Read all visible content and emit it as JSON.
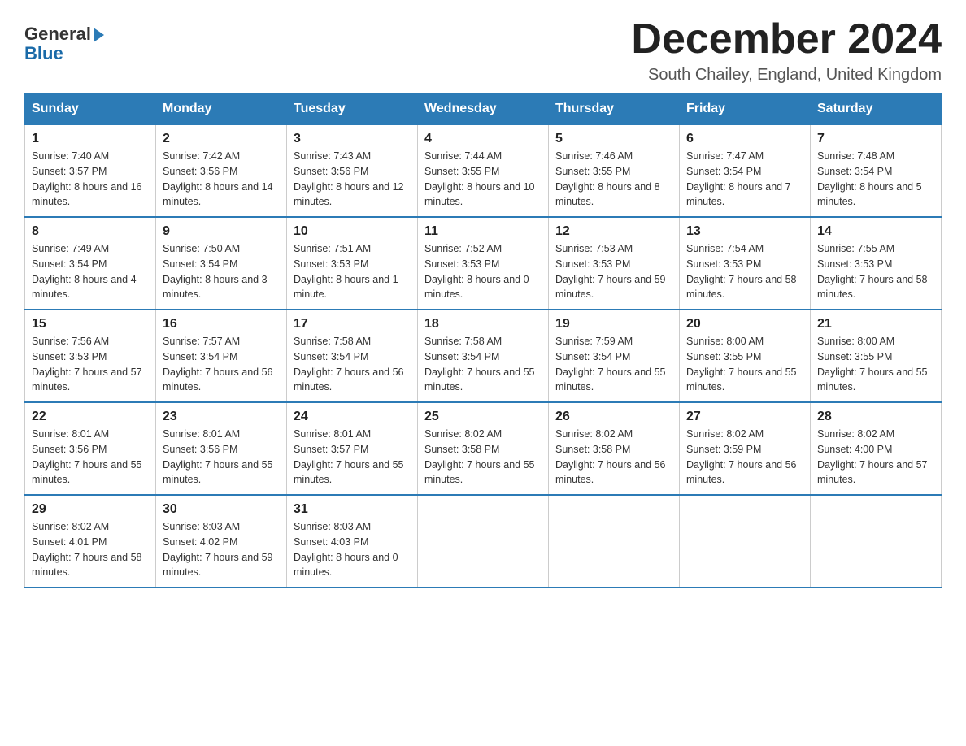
{
  "header": {
    "logo_general": "General",
    "logo_blue": "Blue",
    "title": "December 2024",
    "location": "South Chailey, England, United Kingdom"
  },
  "columns": [
    "Sunday",
    "Monday",
    "Tuesday",
    "Wednesday",
    "Thursday",
    "Friday",
    "Saturday"
  ],
  "weeks": [
    [
      {
        "day": "1",
        "sunrise": "7:40 AM",
        "sunset": "3:57 PM",
        "daylight": "8 hours and 16 minutes."
      },
      {
        "day": "2",
        "sunrise": "7:42 AM",
        "sunset": "3:56 PM",
        "daylight": "8 hours and 14 minutes."
      },
      {
        "day": "3",
        "sunrise": "7:43 AM",
        "sunset": "3:56 PM",
        "daylight": "8 hours and 12 minutes."
      },
      {
        "day": "4",
        "sunrise": "7:44 AM",
        "sunset": "3:55 PM",
        "daylight": "8 hours and 10 minutes."
      },
      {
        "day": "5",
        "sunrise": "7:46 AM",
        "sunset": "3:55 PM",
        "daylight": "8 hours and 8 minutes."
      },
      {
        "day": "6",
        "sunrise": "7:47 AM",
        "sunset": "3:54 PM",
        "daylight": "8 hours and 7 minutes."
      },
      {
        "day": "7",
        "sunrise": "7:48 AM",
        "sunset": "3:54 PM",
        "daylight": "8 hours and 5 minutes."
      }
    ],
    [
      {
        "day": "8",
        "sunrise": "7:49 AM",
        "sunset": "3:54 PM",
        "daylight": "8 hours and 4 minutes."
      },
      {
        "day": "9",
        "sunrise": "7:50 AM",
        "sunset": "3:54 PM",
        "daylight": "8 hours and 3 minutes."
      },
      {
        "day": "10",
        "sunrise": "7:51 AM",
        "sunset": "3:53 PM",
        "daylight": "8 hours and 1 minute."
      },
      {
        "day": "11",
        "sunrise": "7:52 AM",
        "sunset": "3:53 PM",
        "daylight": "8 hours and 0 minutes."
      },
      {
        "day": "12",
        "sunrise": "7:53 AM",
        "sunset": "3:53 PM",
        "daylight": "7 hours and 59 minutes."
      },
      {
        "day": "13",
        "sunrise": "7:54 AM",
        "sunset": "3:53 PM",
        "daylight": "7 hours and 58 minutes."
      },
      {
        "day": "14",
        "sunrise": "7:55 AM",
        "sunset": "3:53 PM",
        "daylight": "7 hours and 58 minutes."
      }
    ],
    [
      {
        "day": "15",
        "sunrise": "7:56 AM",
        "sunset": "3:53 PM",
        "daylight": "7 hours and 57 minutes."
      },
      {
        "day": "16",
        "sunrise": "7:57 AM",
        "sunset": "3:54 PM",
        "daylight": "7 hours and 56 minutes."
      },
      {
        "day": "17",
        "sunrise": "7:58 AM",
        "sunset": "3:54 PM",
        "daylight": "7 hours and 56 minutes."
      },
      {
        "day": "18",
        "sunrise": "7:58 AM",
        "sunset": "3:54 PM",
        "daylight": "7 hours and 55 minutes."
      },
      {
        "day": "19",
        "sunrise": "7:59 AM",
        "sunset": "3:54 PM",
        "daylight": "7 hours and 55 minutes."
      },
      {
        "day": "20",
        "sunrise": "8:00 AM",
        "sunset": "3:55 PM",
        "daylight": "7 hours and 55 minutes."
      },
      {
        "day": "21",
        "sunrise": "8:00 AM",
        "sunset": "3:55 PM",
        "daylight": "7 hours and 55 minutes."
      }
    ],
    [
      {
        "day": "22",
        "sunrise": "8:01 AM",
        "sunset": "3:56 PM",
        "daylight": "7 hours and 55 minutes."
      },
      {
        "day": "23",
        "sunrise": "8:01 AM",
        "sunset": "3:56 PM",
        "daylight": "7 hours and 55 minutes."
      },
      {
        "day": "24",
        "sunrise": "8:01 AM",
        "sunset": "3:57 PM",
        "daylight": "7 hours and 55 minutes."
      },
      {
        "day": "25",
        "sunrise": "8:02 AM",
        "sunset": "3:58 PM",
        "daylight": "7 hours and 55 minutes."
      },
      {
        "day": "26",
        "sunrise": "8:02 AM",
        "sunset": "3:58 PM",
        "daylight": "7 hours and 56 minutes."
      },
      {
        "day": "27",
        "sunrise": "8:02 AM",
        "sunset": "3:59 PM",
        "daylight": "7 hours and 56 minutes."
      },
      {
        "day": "28",
        "sunrise": "8:02 AM",
        "sunset": "4:00 PM",
        "daylight": "7 hours and 57 minutes."
      }
    ],
    [
      {
        "day": "29",
        "sunrise": "8:02 AM",
        "sunset": "4:01 PM",
        "daylight": "7 hours and 58 minutes."
      },
      {
        "day": "30",
        "sunrise": "8:03 AM",
        "sunset": "4:02 PM",
        "daylight": "7 hours and 59 minutes."
      },
      {
        "day": "31",
        "sunrise": "8:03 AM",
        "sunset": "4:03 PM",
        "daylight": "8 hours and 0 minutes."
      },
      null,
      null,
      null,
      null
    ]
  ],
  "labels": {
    "sunrise": "Sunrise:",
    "sunset": "Sunset:",
    "daylight": "Daylight:"
  }
}
